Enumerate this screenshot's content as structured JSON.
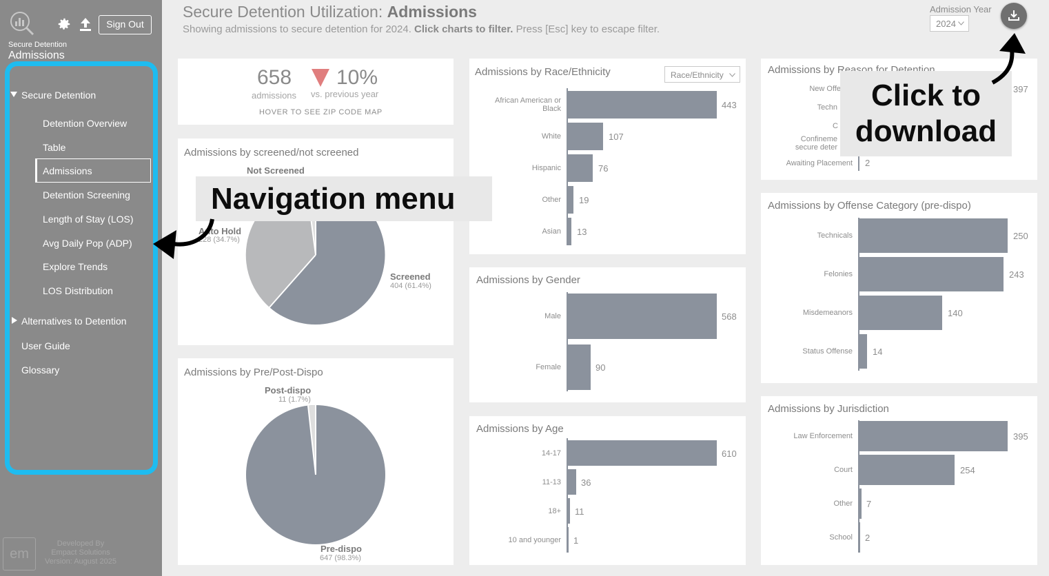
{
  "sidebar": {
    "signout_label": "Sign Out",
    "app_subtitle": "Secure Detention",
    "app_title": "Admissions",
    "sections": [
      {
        "label": "Secure Detention"
      },
      {
        "label": "Alternatives to Detention"
      }
    ],
    "items": [
      {
        "label": "Detention Overview"
      },
      {
        "label": "Table"
      },
      {
        "label": "Admissions"
      },
      {
        "label": "Detention Screening"
      },
      {
        "label": "Length of Stay (LOS)"
      },
      {
        "label": "Avg Daily Pop (ADP)"
      },
      {
        "label": "Explore Trends"
      },
      {
        "label": "LOS Distribution"
      }
    ],
    "links": [
      {
        "label": "User Guide"
      },
      {
        "label": "Glossary"
      }
    ],
    "logo_text": "em",
    "credit_1": "Developed By",
    "credit_2": "Empact Solutions",
    "credit_3": "Version: August 2025"
  },
  "header": {
    "title_prefix": "Secure Detention Utilization: ",
    "title_bold": "Admissions",
    "subtitle_1": "Showing admissions to secure detention for 2024. ",
    "subtitle_bold": "Click charts to filter.",
    "subtitle_2": " Press [Esc] key to escape filter.",
    "year_label": "Admission Year",
    "year_value": "2024"
  },
  "kpi": {
    "count": "658",
    "count_label": "admissions",
    "pct": "10%",
    "pct_label": "vs. previous year",
    "hint": "HOVER TO SEE ZIP CODE MAP"
  },
  "screened": {
    "title": "Admissions by screened/not screened",
    "not_screened": "Not Screened",
    "auto_hold": "Auto Hold",
    "auto_hold_val": "228 (34.7%)",
    "screened_label": "Screened",
    "screened_val": "404 (61.4%)"
  },
  "dispo": {
    "title": "Admissions by Pre/Post-Dispo",
    "post": "Post-dispo",
    "post_val": "11 (1.7%)",
    "pre": "Pre-dispo",
    "pre_val": "647 (98.3%)"
  },
  "race": {
    "title": "Admissions by Race/Ethnicity",
    "select": "Race/Ethnicity",
    "categories": [
      "African American or Black",
      "White",
      "Hispanic",
      "Other",
      "Asian"
    ],
    "values": [
      "443",
      "107",
      "76",
      "19",
      "13"
    ]
  },
  "gender": {
    "title": "Admissions by Gender",
    "categories": [
      "Male",
      "Female"
    ],
    "values": [
      "568",
      "90"
    ]
  },
  "age": {
    "title": "Admissions by Age",
    "categories": [
      "14-17",
      "11-13",
      "18+",
      "10 and younger"
    ],
    "values": [
      "610",
      "36",
      "11",
      "1"
    ]
  },
  "reason": {
    "title": "Admissions by Reason for Detention",
    "labels": [
      "New Offe",
      "Techn",
      "C",
      "Confineme",
      "secure deter",
      "Awaiting Placement"
    ],
    "values": [
      "397",
      "2"
    ]
  },
  "offense": {
    "title": "Admissions by Offense Category (pre-dispo)",
    "categories": [
      "Technicals",
      "Felonies",
      "Misdemeanors",
      "Status Offense"
    ],
    "values": [
      "250",
      "243",
      "140",
      "14"
    ]
  },
  "jurisdiction": {
    "title": "Admissions by Jurisdiction",
    "categories": [
      "Law Enforcement",
      "Court",
      "Other",
      "School"
    ],
    "values": [
      "395",
      "254",
      "7",
      "2"
    ]
  },
  "annotations": {
    "nav": "Navigation menu",
    "dl_1": "Click to",
    "dl_2": "download"
  },
  "colors": {
    "sidebar": "#8a8a8a",
    "highlight": "#1ebcf0",
    "bar": "#8b929d",
    "decline": "#e07e7e"
  }
}
